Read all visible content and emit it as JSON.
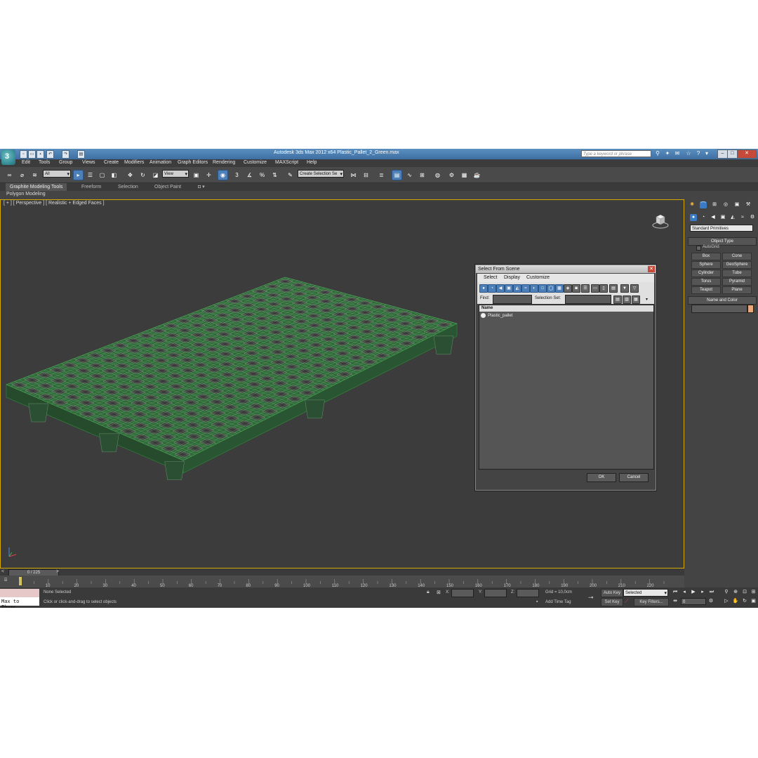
{
  "titlebar": {
    "title": "Autodesk 3ds Max  2012 x64     Plastic_Pallet_2_Green.max",
    "search_placeholder": "Type a keyword or phrase"
  },
  "menus": [
    "Edit",
    "Tools",
    "Group",
    "Views",
    "Create",
    "Modifiers",
    "Animation",
    "Graph Editors",
    "Rendering",
    "Customize",
    "MAXScript",
    "Help"
  ],
  "toolbar": {
    "filter_value": "All",
    "ref_coord_value": "View",
    "selection_set_value": "Create Selection Se",
    "snap_label": "3",
    "percent_snap": "%"
  },
  "ribbon": {
    "tabs": [
      "Graphite Modeling Tools",
      "Freeform",
      "Selection",
      "Object Paint"
    ],
    "panel_label": "Polygon Modeling"
  },
  "viewport": {
    "label": "[ + ] [ Perspective ] [ Realistic + Edged Faces ]",
    "wire_color": "#2f8a3c"
  },
  "dialog": {
    "title": "Select From Scene",
    "menus": [
      "Select",
      "Display",
      "Customize"
    ],
    "find_label": "Find:",
    "selection_set_label": "Selection Set:",
    "column_name": "Name",
    "items": [
      "Plastic_pallet"
    ],
    "ok_label": "OK",
    "cancel_label": "Cancel"
  },
  "command_panel": {
    "category": "Standard Primitives",
    "object_type_title": "Object Type",
    "autogrid_label": "AutoGrid",
    "primitives": [
      "Box",
      "Cone",
      "Sphere",
      "GeoSphere",
      "Cylinder",
      "Tube",
      "Torus",
      "Pyramid",
      "Teapot",
      "Plane"
    ],
    "name_color_title": "Name and Color",
    "swatch_color": "#e8a87c"
  },
  "timeline": {
    "frame_display": "0 / 225",
    "ticks": [
      "10",
      "20",
      "30",
      "40",
      "50",
      "60",
      "70",
      "80",
      "90",
      "100",
      "110",
      "120",
      "130",
      "140",
      "150",
      "160",
      "170",
      "180",
      "190",
      "200",
      "210",
      "220"
    ]
  },
  "status": {
    "maxscript_label": "Max to Physc.",
    "selection": "None Selected",
    "prompt": "Click or click-and-drag to select objects",
    "x_label": "X:",
    "y_label": "Y:",
    "z_label": "Z:",
    "grid": "Grid = 10,0cm",
    "add_time_tag": "Add Time Tag",
    "auto_key": "Auto Key",
    "key_mode_value": "Selected",
    "set_key": "Set Key",
    "key_filters": "Key Filters...",
    "frame_value": "0"
  }
}
